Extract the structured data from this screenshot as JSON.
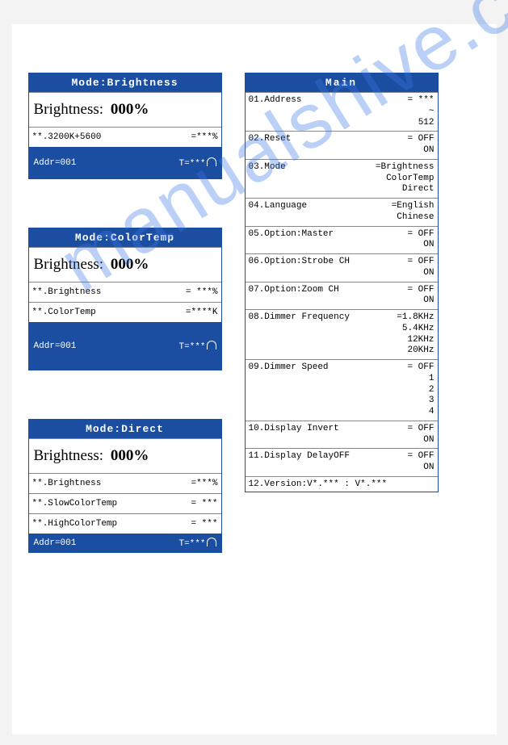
{
  "watermark": "manualshive.com",
  "left": {
    "panel1": {
      "title": "Mode:Brightness",
      "big": "Brightness:",
      "bigval": "000%",
      "row1_label": "**.3200K+5600",
      "row1_val": "=***%",
      "addr": "Addr=001",
      "temp": "T=***"
    },
    "panel2": {
      "title": "Mode:ColorTemp",
      "big": "Brightness:",
      "bigval": "000%",
      "row1_label": "**.Brightness",
      "row1_val": "= ***%",
      "row2_label": "**.ColorTemp",
      "row2_val": "=****K",
      "addr": "Addr=001",
      "temp": "T=***"
    },
    "panel3": {
      "title": "Mode:Direct",
      "big": "Brightness:",
      "bigval": "000%",
      "row1_label": "**.Brightness",
      "row1_val": "=***%",
      "row2_label": "**.SlowColorTemp",
      "row2_val": "= ***",
      "row3_label": "**.HighColorTemp",
      "row3_val": "= ***",
      "addr": "Addr=001",
      "temp": "T=***"
    }
  },
  "main": {
    "title": "Main",
    "items": [
      {
        "label": "01.Address",
        "vals": [
          "= ***",
          "~",
          "512"
        ]
      },
      {
        "label": "02.Reset",
        "vals": [
          "= OFF",
          "ON"
        ]
      },
      {
        "label": "03.Mode",
        "vals": [
          "=Brightness",
          "ColorTemp",
          "Direct"
        ]
      },
      {
        "label": "04.Language",
        "vals": [
          "=English",
          "Chinese"
        ]
      },
      {
        "label": "05.Option:Master",
        "vals": [
          "= OFF",
          "ON"
        ]
      },
      {
        "label": "06.Option:Strobe CH",
        "vals": [
          "= OFF",
          "ON"
        ]
      },
      {
        "label": "07.Option:Zoom CH",
        "vals": [
          "= OFF",
          "ON"
        ]
      },
      {
        "label": "08.Dimmer Frequency",
        "vals": [
          "=1.8KHz",
          "5.4KHz",
          "12KHz",
          "20KHz"
        ]
      },
      {
        "label": "09.Dimmer Speed",
        "vals": [
          "= OFF",
          "1",
          "2",
          "3",
          "4"
        ]
      },
      {
        "label": "10.Display Invert",
        "vals": [
          "= OFF",
          "ON"
        ]
      },
      {
        "label": "11.Display DelayOFF",
        "vals": [
          "= OFF",
          "ON"
        ]
      },
      {
        "label": "12.Version:V*.*** : V*.***",
        "vals": [
          ""
        ]
      }
    ]
  }
}
